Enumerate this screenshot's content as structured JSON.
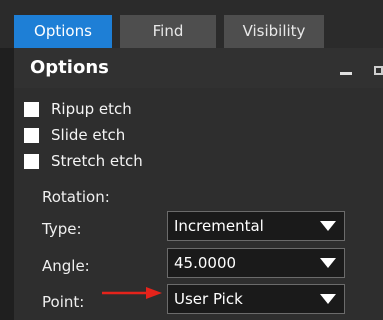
{
  "tabs": [
    {
      "label": "Options",
      "active": true
    },
    {
      "label": "Find",
      "active": false
    },
    {
      "label": "Visibility",
      "active": false
    }
  ],
  "panel": {
    "title": "Options"
  },
  "checkboxes": [
    {
      "label": "Ripup etch",
      "checked": false
    },
    {
      "label": "Slide etch",
      "checked": false
    },
    {
      "label": "Stretch etch",
      "checked": false
    }
  ],
  "rotation": {
    "section_label": "Rotation:",
    "type": {
      "label": "Type:",
      "value": "Incremental"
    },
    "angle": {
      "label": "Angle:",
      "value": "45.0000"
    },
    "point": {
      "label": "Point:",
      "value": "User Pick"
    }
  },
  "colors": {
    "accent": "#1e7fd6",
    "annotation_arrow": "#e5231b"
  },
  "icons": {
    "minimize": "minimize-icon",
    "restore": "restore-icon",
    "dropdown": "chevron-down-icon",
    "annotation": "red-arrow-icon"
  }
}
